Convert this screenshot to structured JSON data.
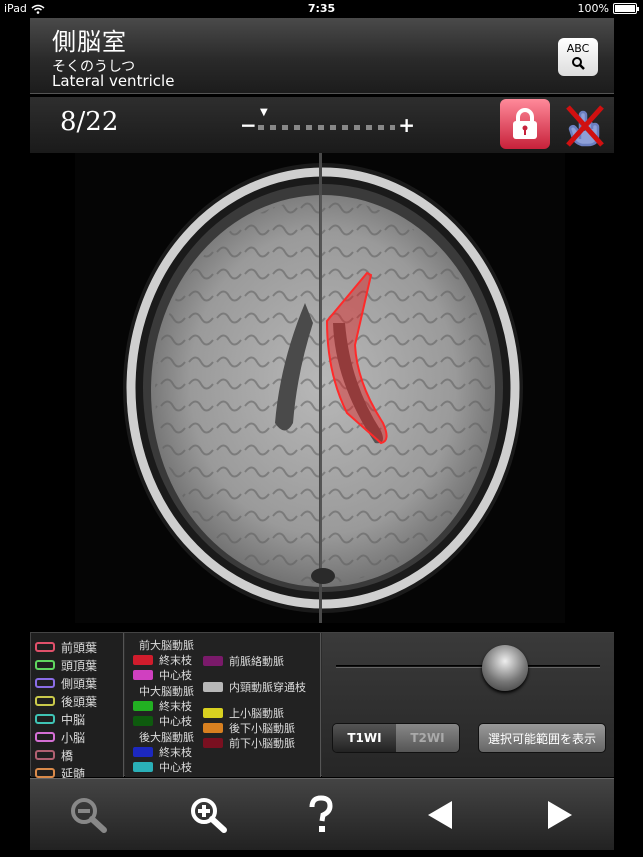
{
  "status_bar": {
    "device": "iPad",
    "time": "7:35",
    "battery": "100%"
  },
  "header": {
    "title_jp": "側脳室",
    "title_kana": "そくのうしつ",
    "title_en": "Lateral ventricle",
    "abc_label": "ABC"
  },
  "slice": {
    "current": "8/22",
    "zoom_level": 0.1
  },
  "legend_regions": [
    {
      "label": "前頭葉",
      "color": "#e0506a"
    },
    {
      "label": "頭頂葉",
      "color": "#5fd65f"
    },
    {
      "label": "側頭葉",
      "color": "#8a6de6"
    },
    {
      "label": "後頭葉",
      "color": "#c9c94a"
    },
    {
      "label": "中脳",
      "color": "#3fc4b5"
    },
    {
      "label": "小脳",
      "color": "#d46fd4"
    },
    {
      "label": "橋",
      "color": "#b06070"
    },
    {
      "label": "延髄",
      "color": "#d98a4a"
    }
  ],
  "legend_arteries": {
    "aca": {
      "header": "前大脳動脈",
      "terminal": "終末枝",
      "central": "中心枝",
      "terminal_color": "#d01c2c",
      "central_color": "#d040c0"
    },
    "mca": {
      "header": "中大脳動脈",
      "terminal": "終末枝",
      "central": "中心枝",
      "terminal_color": "#22b022",
      "central_color": "#0e5a0e"
    },
    "pca": {
      "header": "後大脳動脈",
      "terminal": "終末枝",
      "central": "中心枝",
      "terminal_color": "#1c28c0",
      "central_color": "#2ab0b8"
    },
    "others": [
      {
        "label": "前脈絡動脈",
        "color": "#7a1a6a"
      },
      {
        "label": "内頸動脈穿通枝",
        "color": "#b8b8b8"
      },
      {
        "label": "上小脳動脈",
        "color": "#d8d020"
      },
      {
        "label": "後下小脳動脈",
        "color": "#d88020"
      },
      {
        "label": "前下小脳動脈",
        "color": "#7a1020"
      }
    ]
  },
  "controls": {
    "t1_label": "T1WI",
    "t2_label": "T2WI",
    "range_button": "選択可能範囲を表示"
  },
  "highlight_color": "#e01c1c"
}
